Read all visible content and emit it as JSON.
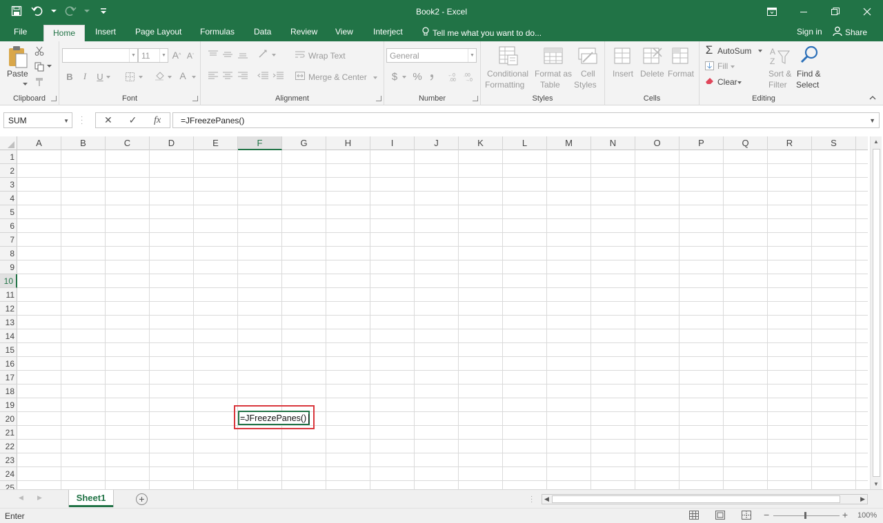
{
  "window": {
    "title": "Book2 - Excel",
    "controls": [
      "ribbon-display-options",
      "minimize",
      "restore",
      "close"
    ]
  },
  "ribbon_tabs": [
    "File",
    "Home",
    "Insert",
    "Page Layout",
    "Formulas",
    "Data",
    "Review",
    "View",
    "Interject"
  ],
  "active_tab": "Home",
  "tell_me": "Tell me what you want to do...",
  "sign_in": "Sign in",
  "share": "Share",
  "ribbon": {
    "clipboard": {
      "label": "Clipboard",
      "paste": "Paste"
    },
    "font": {
      "label": "Font",
      "name": "",
      "size": "11",
      "bold": "B",
      "italic": "I",
      "underline": "U"
    },
    "alignment": {
      "label": "Alignment",
      "wrap_text": "Wrap Text",
      "merge_center": "Merge & Center"
    },
    "number": {
      "label": "Number",
      "format": "General",
      "currency": "$",
      "percent": "%"
    },
    "styles": {
      "label": "Styles",
      "conditional_formatting_1": "Conditional",
      "conditional_formatting_2": "Formatting",
      "format_as_table_1": "Format as",
      "format_as_table_2": "Table",
      "cell_styles_1": "Cell",
      "cell_styles_2": "Styles"
    },
    "cells": {
      "label": "Cells",
      "insert": "Insert",
      "delete": "Delete",
      "format": "Format"
    },
    "editing": {
      "label": "Editing",
      "autosum": "AutoSum",
      "fill": "Fill",
      "clear": "Clear",
      "sort_filter_1": "Sort &",
      "sort_filter_2": "Filter",
      "find_select_1": "Find &",
      "find_select_2": "Select"
    }
  },
  "formula_bar": {
    "name_box": "SUM",
    "cancel": "✕",
    "enter": "✓",
    "fx": "fx",
    "formula": "=JFreezePanes()"
  },
  "grid": {
    "columns": [
      "A",
      "B",
      "C",
      "D",
      "E",
      "F",
      "G",
      "H",
      "I",
      "J",
      "K",
      "L",
      "M",
      "N",
      "O",
      "P",
      "Q",
      "R",
      "S"
    ],
    "rows": [
      "1",
      "2",
      "3",
      "4",
      "5",
      "6",
      "7",
      "8",
      "9",
      "10",
      "11",
      "12",
      "13",
      "14",
      "15",
      "16",
      "17",
      "18",
      "19",
      "20",
      "21",
      "22",
      "23",
      "24",
      "25"
    ],
    "selected_column": "F",
    "selected_row": "10",
    "active_cell_value": "=JFreezePanes()"
  },
  "sheets": [
    "Sheet1"
  ],
  "active_sheet": "Sheet1",
  "status": {
    "mode": "Enter",
    "zoom": "100%"
  },
  "colors": {
    "brand": "#217346",
    "highlight": "#d9353b"
  }
}
